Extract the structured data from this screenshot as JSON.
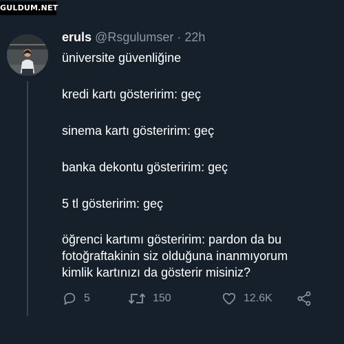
{
  "watermark": "GULDUM.NET",
  "tweet": {
    "name": "eruls",
    "handle": "@Rsgulumser",
    "separator": "·",
    "time": "22h",
    "lines": [
      "üniversite güvenliğine",
      "kredi kartı gösteririm: geç",
      "sinema kartı gösteririm: geç",
      "banka dekontu gösteririm: geç",
      "5 tl gösteririm: geç",
      "öğrenci kartımı gösteririm: pardon da bu",
      "fotoğraftakinin siz olduğuna inanmıyorum",
      "kimlik kartınızı da gösterir misiniz?"
    ]
  },
  "actions": {
    "reply": {
      "icon": "reply-icon",
      "count": "5"
    },
    "retweet": {
      "icon": "retweet-icon",
      "count": "150"
    },
    "like": {
      "icon": "heart-icon",
      "count": "12.6K"
    },
    "share": {
      "icon": "share-icon"
    }
  },
  "colors": {
    "background": "#15202b",
    "text": "#ffffff",
    "secondary": "#8899a6",
    "thread_line": "#38444d"
  }
}
